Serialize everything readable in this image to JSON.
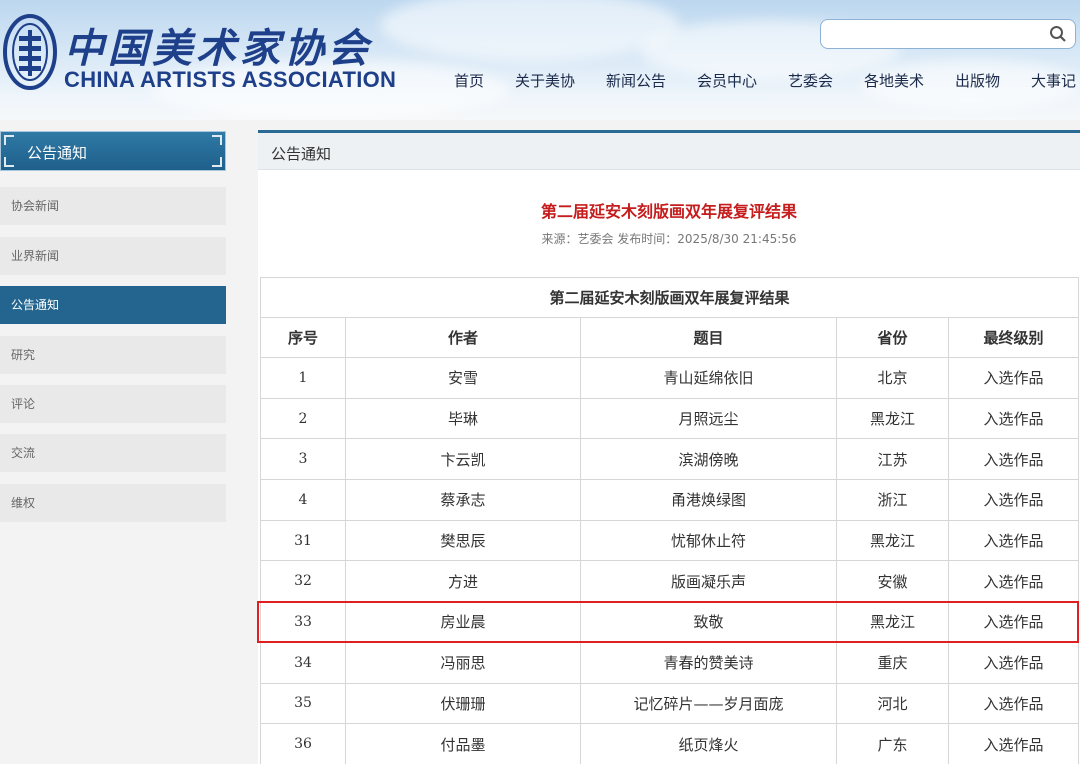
{
  "site": {
    "name_cn": "中国美术家协会",
    "name_en": "CHINA ARTISTS ASSOCIATION"
  },
  "search": {
    "placeholder": ""
  },
  "nav": [
    "首页",
    "关于美协",
    "新闻公告",
    "会员中心",
    "艺委会",
    "各地美术",
    "出版物",
    "大事记"
  ],
  "sidebar": {
    "title": "公告通知",
    "items": [
      "协会新闻",
      "业界新闻",
      "公告通知",
      "研究",
      "评论",
      "交流",
      "维权"
    ],
    "active_index": 2
  },
  "main": {
    "section_title": "公告通知",
    "article_title": "第二届延安木刻版画双年展复评结果",
    "meta": "来源：艺委会 发布时间：2025/8/30 21:45:56"
  },
  "table": {
    "caption": "第二届延安木刻版画双年展复评结果",
    "headers": [
      "序号",
      "作者",
      "题目",
      "省份",
      "最终级别"
    ],
    "rows": [
      [
        "1",
        "安雪",
        "青山延绵依旧",
        "北京",
        "入选作品"
      ],
      [
        "2",
        "毕琳",
        "月照远尘",
        "黑龙江",
        "入选作品"
      ],
      [
        "3",
        "卞云凯",
        "滨湖傍晚",
        "江苏",
        "入选作品"
      ],
      [
        "4",
        "蔡承志",
        "甬港焕绿图",
        "浙江",
        "入选作品"
      ],
      [
        "31",
        "樊思辰",
        "忧郁休止符",
        "黑龙江",
        "入选作品"
      ],
      [
        "32",
        "方进",
        "版画凝乐声",
        "安徽",
        "入选作品"
      ],
      [
        "33",
        "房业晨",
        "致敬",
        "黑龙江",
        "入选作品"
      ],
      [
        "34",
        "冯丽思",
        "青春的赞美诗",
        "重庆",
        "入选作品"
      ],
      [
        "35",
        "伏珊珊",
        "记忆碎片——岁月面庞",
        "河北",
        "入选作品"
      ],
      [
        "36",
        "付品墨",
        "纸页烽火",
        "广东",
        "入选作品"
      ]
    ],
    "highlight_row": 6
  },
  "colors": {
    "brand_blue": "#1e3f8a",
    "sidebar_active": "#23658f",
    "title_red": "#c51d1d",
    "highlight_red": "#e02020"
  }
}
